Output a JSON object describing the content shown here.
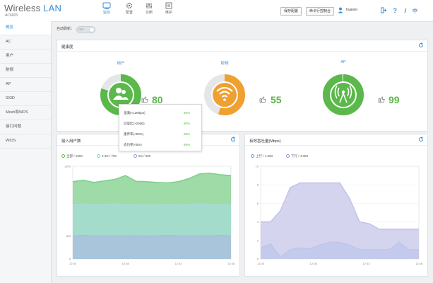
{
  "header": {
    "brand_wireless": "Wireless",
    "brand_lan": "LAN",
    "model": "AC6003",
    "nav": [
      {
        "label": "监控",
        "icon": "monitor-icon"
      },
      {
        "label": "配置",
        "icon": "gear-icon"
      },
      {
        "label": "诊断",
        "icon": "sliders-icon"
      },
      {
        "label": "维护",
        "icon": "wrench-icon"
      }
    ],
    "save_btn": "保存配置",
    "cli_btn": "命令行控制台",
    "username": "huawei"
  },
  "sidebar": {
    "items": [
      "概览",
      "AC",
      "用户",
      "射频",
      "AP",
      "SSID",
      "Mesh和WDS",
      "接口问题",
      "WIDS"
    ]
  },
  "main": {
    "auto_refresh_label": "自动刷新：",
    "toggle_text": "OFF",
    "health": {
      "title": "健康度",
      "gauges": [
        {
          "label": "用户",
          "score": "80",
          "value": 80,
          "color": "#5bb84a"
        },
        {
          "label": "射频",
          "score": "55",
          "value": 55,
          "color": "#f0a030"
        },
        {
          "label": "AP",
          "score": "99",
          "value": 99,
          "color": "#5bb84a"
        }
      ],
      "popup": [
        {
          "label": "强满(<12Mbps)",
          "pct": "80%"
        },
        {
          "label": "信噪比(>20dB)",
          "pct": "80%"
        },
        {
          "label": "重传率(<50%)",
          "pct": "85%"
        },
        {
          "label": "丢包率(<5%)",
          "pct": "88%"
        }
      ]
    },
    "users_panel": {
      "title": "接入用户数",
      "legend": [
        "全部 / 1000",
        "2.4G / 700",
        "5G / 300"
      ]
    },
    "traffic_panel": {
      "title": "有效吞吐量(Mbps)",
      "legend": [
        "上行 / 1.093",
        "下行 / 4.083"
      ]
    }
  },
  "colors": {
    "accent": "#3b8fd6",
    "green": "#5bb84a",
    "orange": "#f0a030"
  },
  "chart_data": [
    {
      "type": "area",
      "title": "接入用户数",
      "x": [
        "12:03",
        "12:08",
        "12:43",
        "12:48"
      ],
      "ylim": [
        0,
        1200
      ],
      "yticks": [
        "1200",
        "300",
        "0"
      ],
      "series": [
        {
          "name": "全部 / 1000",
          "values": [
            1000,
            1020,
            990,
            1010,
            1030,
            1080,
            1005,
            1000,
            990,
            985,
            1000,
            1040,
            1100,
            1110,
            1090,
            1080
          ],
          "color": "#7fcf8a"
        },
        {
          "name": "2.4G / 700",
          "values": [
            700,
            710,
            700,
            705,
            710,
            705,
            700,
            695,
            700,
            705,
            700,
            705,
            710,
            705,
            700,
            705
          ],
          "color": "#a6dcd7"
        },
        {
          "name": "5G / 300",
          "values": [
            300,
            305,
            295,
            300,
            298,
            302,
            300,
            295,
            300,
            305,
            300,
            298,
            302,
            300,
            305,
            300
          ],
          "color": "#a9bde0"
        }
      ]
    },
    {
      "type": "area",
      "title": "有效吞吐量(Mbps)",
      "x": [
        "12:03",
        "12:08",
        "12:43",
        "12:48"
      ],
      "ylim": [
        0,
        10
      ],
      "yticks": [
        "10",
        "8",
        "6",
        "4",
        "2",
        "0"
      ],
      "series": [
        {
          "name": "上行 / 1.093",
          "values": [
            1.2,
            1.6,
            0.2,
            1.0,
            1.2,
            1.1,
            1.5,
            1.8,
            1.8,
            1.5,
            1.0,
            1.0,
            1.0,
            1.0,
            1.8,
            1.0,
            1.0
          ],
          "color": "#a8c8ec"
        },
        {
          "name": "下行 / 4.083",
          "values": [
            4.0,
            4.0,
            5.2,
            7.7,
            8.2,
            8.2,
            8.2,
            8.2,
            8.2,
            6.5,
            4.0,
            3.8,
            3.2,
            3.2,
            3.2,
            3.2,
            3.2
          ],
          "color": "#c5c5e8"
        }
      ]
    }
  ]
}
